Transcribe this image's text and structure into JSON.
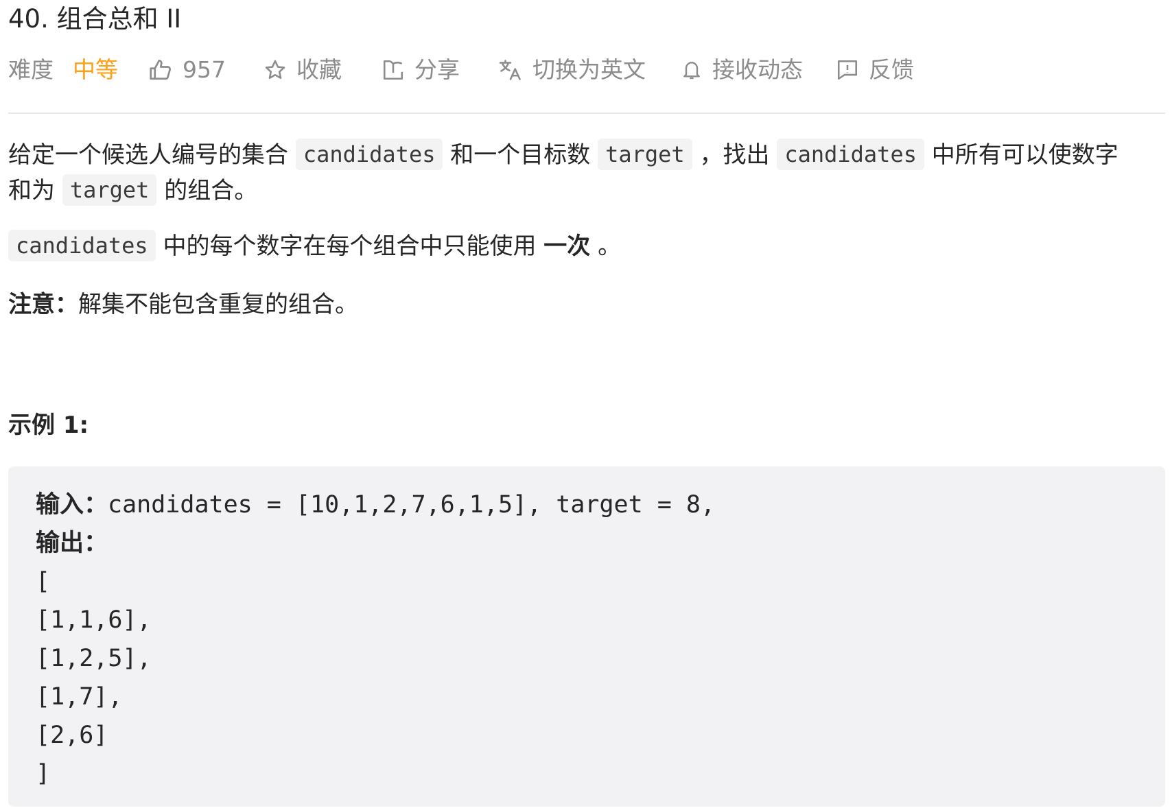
{
  "problem": {
    "title": "40. 组合总和 II"
  },
  "toolbar": {
    "difficulty_label": "难度",
    "difficulty_value": "中等",
    "difficulty_color": "#ffa116",
    "likes": "957",
    "favorite": "收藏",
    "share": "分享",
    "translate": "切换为英文",
    "subscribe": "接收动态",
    "feedback": "反馈",
    "icons": [
      "thumbs-up-icon",
      "star-icon",
      "share-icon",
      "translate-icon",
      "bell-icon",
      "feedback-icon"
    ]
  },
  "description": {
    "p1_t1": "给定一个候选人编号的集合",
    "p1_c1": "candidates",
    "p1_t2": "和一个目标数",
    "p1_c2": "target",
    "p1_t3": "，找出",
    "p1_c3": "candidates",
    "p1_t4": "中所有可以使数字",
    "p1_t5": "和为",
    "p1_c4": "target",
    "p1_t6": "的组合。",
    "p2_c1": "candidates",
    "p2_t1": "中的每个数字在每个组合中只能使用",
    "p2_strong": "一次",
    "p2_t2": "。",
    "note_label": "注意：",
    "note_text": "解集不能包含重复的组合。"
  },
  "example": {
    "title": "示例 1:",
    "input_label": "输入：",
    "input_value": "candidates = [10,1,2,7,6,1,5], target = 8,",
    "output_label": "输出：",
    "output_lines": [
      "[",
      "[1,1,6],",
      "[1,2,5],",
      "[1,7],",
      "[2,6]",
      "]"
    ]
  }
}
